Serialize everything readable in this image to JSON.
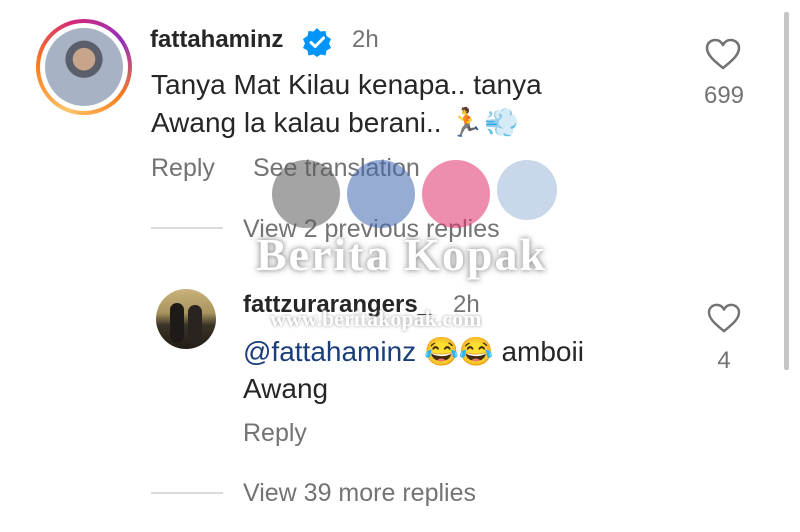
{
  "comment": {
    "username": "fattahaminz",
    "time": "2h",
    "text_line1": "Tanya Mat Kilau kenapa.. tanya",
    "text_line2": "Awang la kalau berani.. 🏃💨",
    "like_count": "699",
    "reply_label": "Reply",
    "translate_label": "See translation"
  },
  "previous_replies_label": "View 2 previous replies",
  "reply": {
    "username": "fattzurarangers_",
    "time": "2h",
    "mention": "@fattahaminz",
    "text_rest": " 😂😂 amboii",
    "text_line2": "Awang",
    "like_count": "4",
    "reply_label": "Reply"
  },
  "more_replies_label": "View 39 more replies",
  "watermark": {
    "brand": "Berita Kopak",
    "url": "www.beritakopak.com"
  },
  "colors": {
    "verified": "#0095f6",
    "secondary_text": "#737373",
    "primary_text": "#262626",
    "mention": "#1a3e7a"
  }
}
